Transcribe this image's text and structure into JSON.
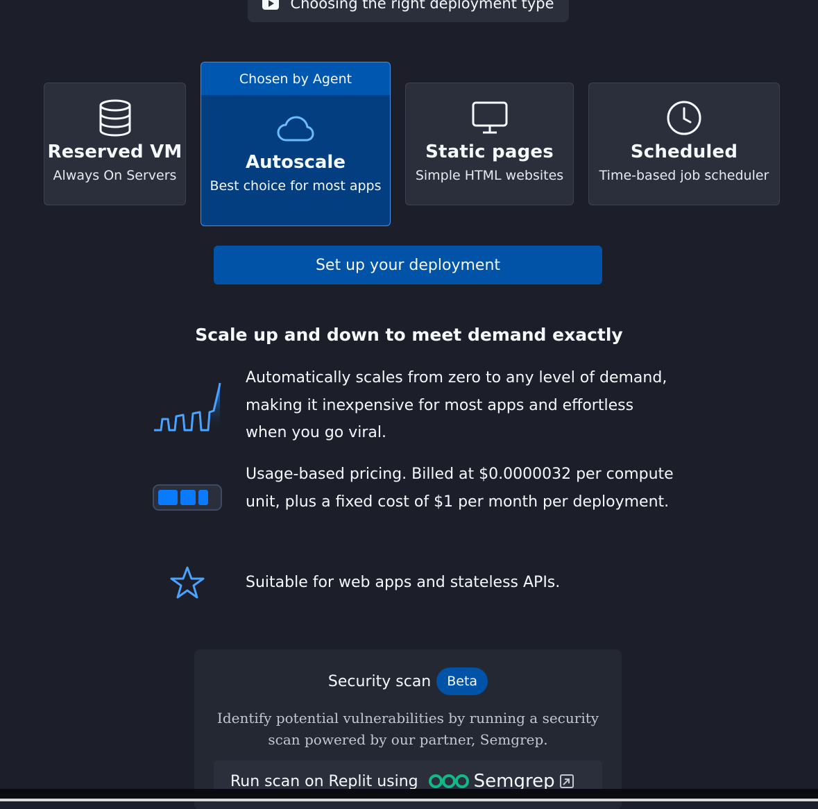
{
  "video_link": {
    "label": "Choosing the right deployment type",
    "icon": "play-icon"
  },
  "deployment_types": [
    {
      "id": "reserved-vm",
      "title": "Reserved VM",
      "subtitle": "Always On Servers",
      "icon": "database-icon"
    },
    {
      "id": "autoscale",
      "title": "Autoscale",
      "subtitle": "Best choice for most apps",
      "icon": "cloud-icon",
      "badge": "Chosen by Agent",
      "selected": true
    },
    {
      "id": "static-pages",
      "title": "Static pages",
      "subtitle": "Simple HTML websites",
      "icon": "monitor-icon"
    },
    {
      "id": "scheduled",
      "title": "Scheduled",
      "subtitle": "Time-based job scheduler",
      "icon": "clock-icon"
    }
  ],
  "setup_button": {
    "label": "Set up your deployment"
  },
  "details": {
    "heading": "Scale up and down to meet demand exactly",
    "features": [
      {
        "icon": "scaling-graph-icon",
        "text": "Automatically scales from zero to any level of demand, making it inexpensive for most apps and effortless when you go viral."
      },
      {
        "icon": "battery-icon",
        "text": "Usage-based pricing. Billed at $0.0000032 per compute unit, plus a fixed cost of $1 per month per deployment."
      },
      {
        "icon": "star-icon",
        "text": "Suitable for web apps and stateless APIs."
      }
    ]
  },
  "security_scan": {
    "title": "Security scan",
    "badge": "Beta",
    "description": "Identify potential vulnerabilities by running a security scan powered by our partner, Semgrep.",
    "button_label": "Run scan on Replit using",
    "partner_name": "Semgrep",
    "partner_color": "#12b886"
  },
  "colors": {
    "background": "#1c1f2a",
    "card": "#2b2f3b",
    "selected_card": "#033f80",
    "accent_blue": "#0053a6",
    "icon_blue": "#4aa3ff"
  }
}
